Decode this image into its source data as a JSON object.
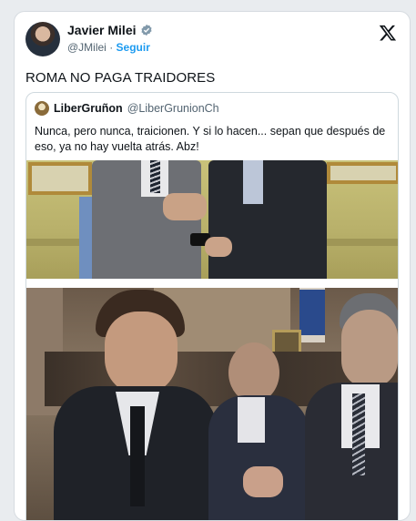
{
  "tweet": {
    "author_name": "Javier Milei",
    "author_handle": "@JMilei",
    "separator": "·",
    "follow_label": "Seguir",
    "text": "ROMA NO PAGA TRAIDORES"
  },
  "quote": {
    "author_name": "LiberGruñon",
    "author_handle": "@LiberGrunionCh",
    "text": "Nunca, pero nunca, traicionen. Y si lo hacen... sepan que después de eso, ya no hay vuelta atrás. Abz!"
  },
  "icons": {
    "verified": "verified-badge-icon",
    "platform": "x-logo-icon"
  },
  "colors": {
    "accent": "#1d9bf0",
    "text": "#0f1419",
    "muted": "#536471"
  }
}
